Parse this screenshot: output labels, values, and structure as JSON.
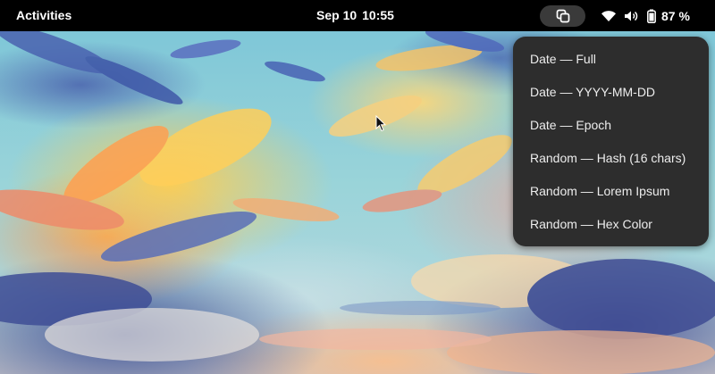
{
  "topbar": {
    "activities_label": "Activities",
    "clock": {
      "date": "Sep 10",
      "time": "10:55"
    },
    "extension_icon": "copy-icon",
    "status": {
      "wifi_icon": "wifi-icon",
      "volume_icon": "volume-icon",
      "battery_icon": "battery-icon",
      "battery_label": "87 %"
    }
  },
  "menu": {
    "items": [
      {
        "label": "Date — Full"
      },
      {
        "label": "Date — YYYY-MM-DD"
      },
      {
        "label": "Date — Epoch"
      },
      {
        "label": "Random — Hash (16 chars)"
      },
      {
        "label": "Random — Lorem Ipsum"
      },
      {
        "label": "Random — Hex Color"
      }
    ]
  },
  "colors": {
    "topbar_bg": "#000000",
    "menu_bg": "#2d2d2d",
    "menu_text": "#ededed",
    "ext_button_bg": "#3a3a3a"
  }
}
